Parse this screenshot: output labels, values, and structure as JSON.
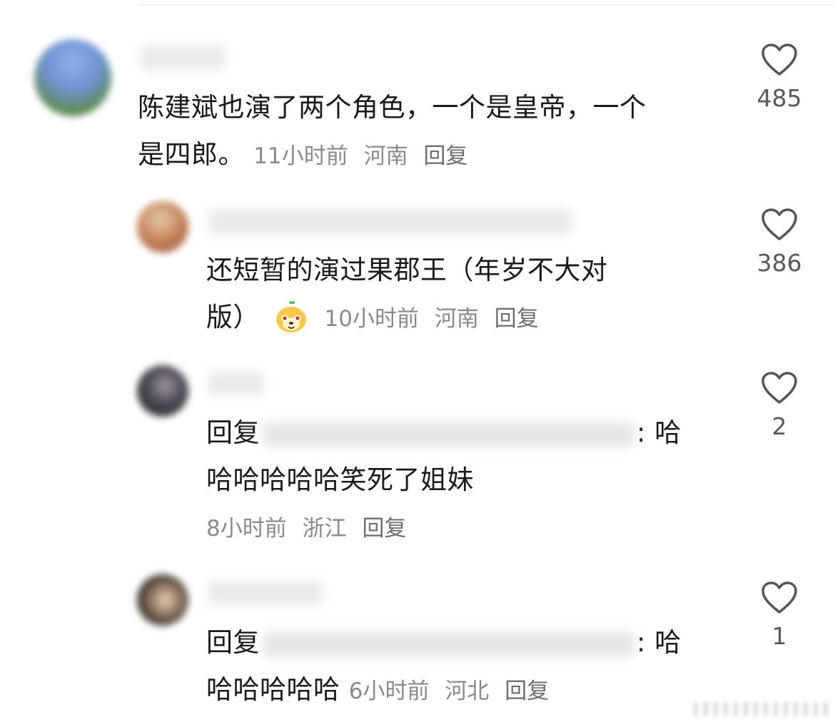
{
  "comments": [
    {
      "text_line1": "陈建斌也演了两个角色，一个是皇帝，一个",
      "text_line2": "是四郎。",
      "time": "11小时前",
      "location": "河南",
      "reply_label": "回复",
      "likes": "485"
    },
    {
      "text_line1": "还短暂的演过果郡王（年岁不大对",
      "text_line2": "版）",
      "emoji": "yellow-character-emoji",
      "time": "10小时前",
      "location": "河南",
      "reply_label": "回复",
      "likes": "386"
    },
    {
      "reply_prefix": "回复",
      "colon": ": 哈",
      "text_line2": "哈哈哈哈哈笑死了姐妹",
      "time": "8小时前",
      "location": "浙江",
      "reply_label": "回复",
      "likes": "2"
    },
    {
      "reply_prefix": "回复",
      "colon": ": 哈",
      "text_line2": "哈哈哈哈哈",
      "time": "6小时前",
      "location": "河北",
      "reply_label": "回复",
      "likes": "1"
    }
  ],
  "colors": {
    "text": "#1a1a1a",
    "meta": "#8a8a8a",
    "heart_stroke": "#555555"
  },
  "icons": {
    "like": "heart-outline-icon"
  }
}
